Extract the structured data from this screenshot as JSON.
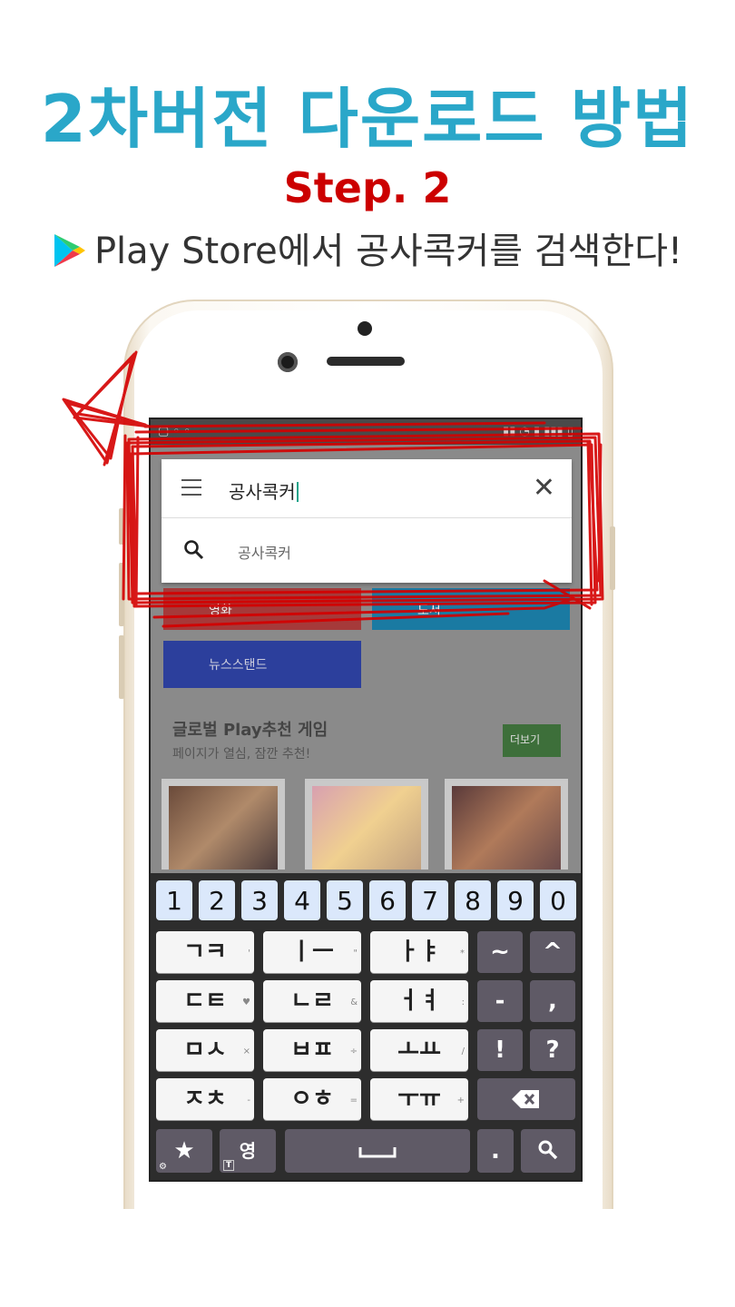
{
  "header": {
    "title": "2차버전 다운로드 방법",
    "step": "Step. 2",
    "instruction": "Play Store에서 공사콕커를 검색한다!"
  },
  "search": {
    "query": "공사콕커",
    "suggestion": "공사콕커"
  },
  "background": {
    "button1": "영화",
    "button2": "도서",
    "button3": "뉴스스탠드",
    "section_title": "글로벌 Play추천 게임",
    "section_sub": "페이지가 열심, 잠깐 추천!",
    "more_button": "더보기"
  },
  "keyboard": {
    "numbers": [
      "1",
      "2",
      "3",
      "4",
      "5",
      "6",
      "7",
      "8",
      "9",
      "0"
    ],
    "rows": [
      {
        "keys": [
          "ㄱㅋ",
          "ㅣㅡ",
          "ㅏㅑ"
        ],
        "syms": [
          "'",
          "\"",
          "*"
        ]
      },
      {
        "keys": [
          "ㄷㅌ",
          "ㄴㄹ",
          "ㅓㅕ"
        ],
        "syms": [
          "♥",
          "&",
          ":"
        ]
      },
      {
        "keys": [
          "ㅁㅅ",
          "ㅂㅍ",
          "ㅗㅛ"
        ],
        "syms": [
          "×",
          "÷",
          "/"
        ]
      },
      {
        "keys": [
          "ㅈㅊ",
          "ㅇㅎ",
          "ㅜㅠ"
        ],
        "syms": [
          "-",
          "=",
          "+"
        ]
      }
    ],
    "right_col": [
      [
        "~",
        "^"
      ],
      [
        "-",
        ","
      ],
      [
        "!",
        "?"
      ]
    ],
    "star": "★",
    "lang": "영",
    "dot": ".",
    "mini_t": "T"
  },
  "colors": {
    "title": "#2aa7c9",
    "step": "#cc0000",
    "scribble": "#d40000",
    "key_num": "#dbe8fb",
    "key_gray": "#5f5a66"
  }
}
